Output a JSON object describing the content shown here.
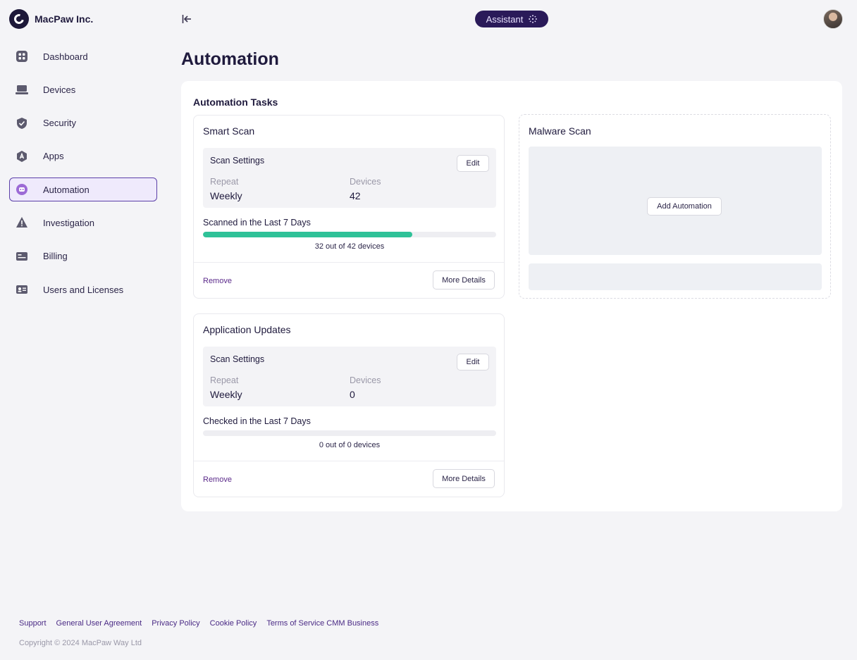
{
  "brand": {
    "name": "MacPaw Inc.",
    "logo_icon": "macpaw-logo-icon"
  },
  "topbar": {
    "assistant_label": "Assistant"
  },
  "sidebar": {
    "items": [
      {
        "label": "Dashboard",
        "icon": "dashboard-icon"
      },
      {
        "label": "Devices",
        "icon": "laptop-icon"
      },
      {
        "label": "Security",
        "icon": "shield-icon"
      },
      {
        "label": "Apps",
        "icon": "apps-icon"
      },
      {
        "label": "Automation",
        "icon": "automation-icon",
        "active": true
      },
      {
        "label": "Investigation",
        "icon": "warning-icon"
      },
      {
        "label": "Billing",
        "icon": "billing-card-icon"
      },
      {
        "label": "Users and Licenses",
        "icon": "users-id-icon"
      }
    ]
  },
  "main": {
    "title": "Automation",
    "section_title": "Automation Tasks",
    "tasks": [
      {
        "title": "Smart Scan",
        "settings_title": "Scan Settings",
        "edit_label": "Edit",
        "repeat_label": "Repeat",
        "repeat_value": "Weekly",
        "devices_label": "Devices",
        "devices_value": "42",
        "progress_label": "Scanned in the Last 7 Days",
        "progress_caption": "32 out of 42 devices",
        "progress_fraction": 0.7143,
        "remove_label": "Remove",
        "details_label": "More Details"
      },
      {
        "title": "Application Updates",
        "settings_title": "Scan Settings",
        "edit_label": "Edit",
        "repeat_label": "Repeat",
        "repeat_value": "Weekly",
        "devices_label": "Devices",
        "devices_value": "0",
        "progress_label": "Checked in the Last 7 Days",
        "progress_caption": "0 out of 0 devices",
        "progress_fraction": 0,
        "remove_label": "Remove",
        "details_label": "More Details"
      }
    ],
    "malware": {
      "title": "Malware Scan",
      "add_label": "Add Automation"
    }
  },
  "footer": {
    "links": [
      "Support",
      "General User Agreement",
      "Privacy Policy",
      "Cookie Policy",
      "Terms of Service CMM Business"
    ],
    "copyright": "Copyright © 2024 MacPaw Way Ltd"
  },
  "colors": {
    "accent": "#5b3fa8",
    "progress": "#2fc298",
    "assistant_bg": "#2a1a59"
  }
}
